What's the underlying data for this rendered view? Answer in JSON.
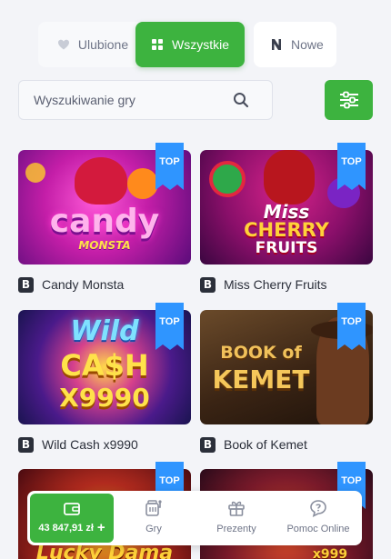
{
  "tabs": [
    {
      "label": "Ulubione",
      "icon": "heart-icon"
    },
    {
      "label": "Wszystkie",
      "icon": "grid-icon",
      "active": true
    },
    {
      "label": "Nowe",
      "icon": "new-n-icon"
    }
  ],
  "search": {
    "placeholder": "Wyszukiwanie gry"
  },
  "badge_label": "TOP",
  "games": [
    {
      "title": "Candy Monsta",
      "provider": "B",
      "art": [
        "candy",
        "MONSTA"
      ]
    },
    {
      "title": "Miss Cherry Fruits",
      "provider": "B",
      "art": [
        "Miss",
        "CHERRY",
        "FRUITS"
      ]
    },
    {
      "title": "Wild Cash x9990",
      "provider": "B",
      "art": [
        "Wild",
        "CA$H",
        "X9990"
      ]
    },
    {
      "title": "Book of Kemet",
      "provider": "B",
      "art": [
        "BOOK of",
        "KEMET"
      ]
    },
    {
      "art": [
        "Lucky Dama"
      ]
    },
    {
      "art": [
        "x999"
      ]
    }
  ],
  "bottom_nav": {
    "balance": "43 847,91 zł",
    "items": [
      {
        "label": "Gry",
        "icon": "slot-machine-icon"
      },
      {
        "label": "Prezenty",
        "icon": "gift-icon"
      },
      {
        "label": "Pomoc Online",
        "icon": "help-chat-icon"
      }
    ]
  },
  "colors": {
    "accent": "#3db33f",
    "badge": "#2f95ff",
    "background": "#f3f4f8"
  }
}
